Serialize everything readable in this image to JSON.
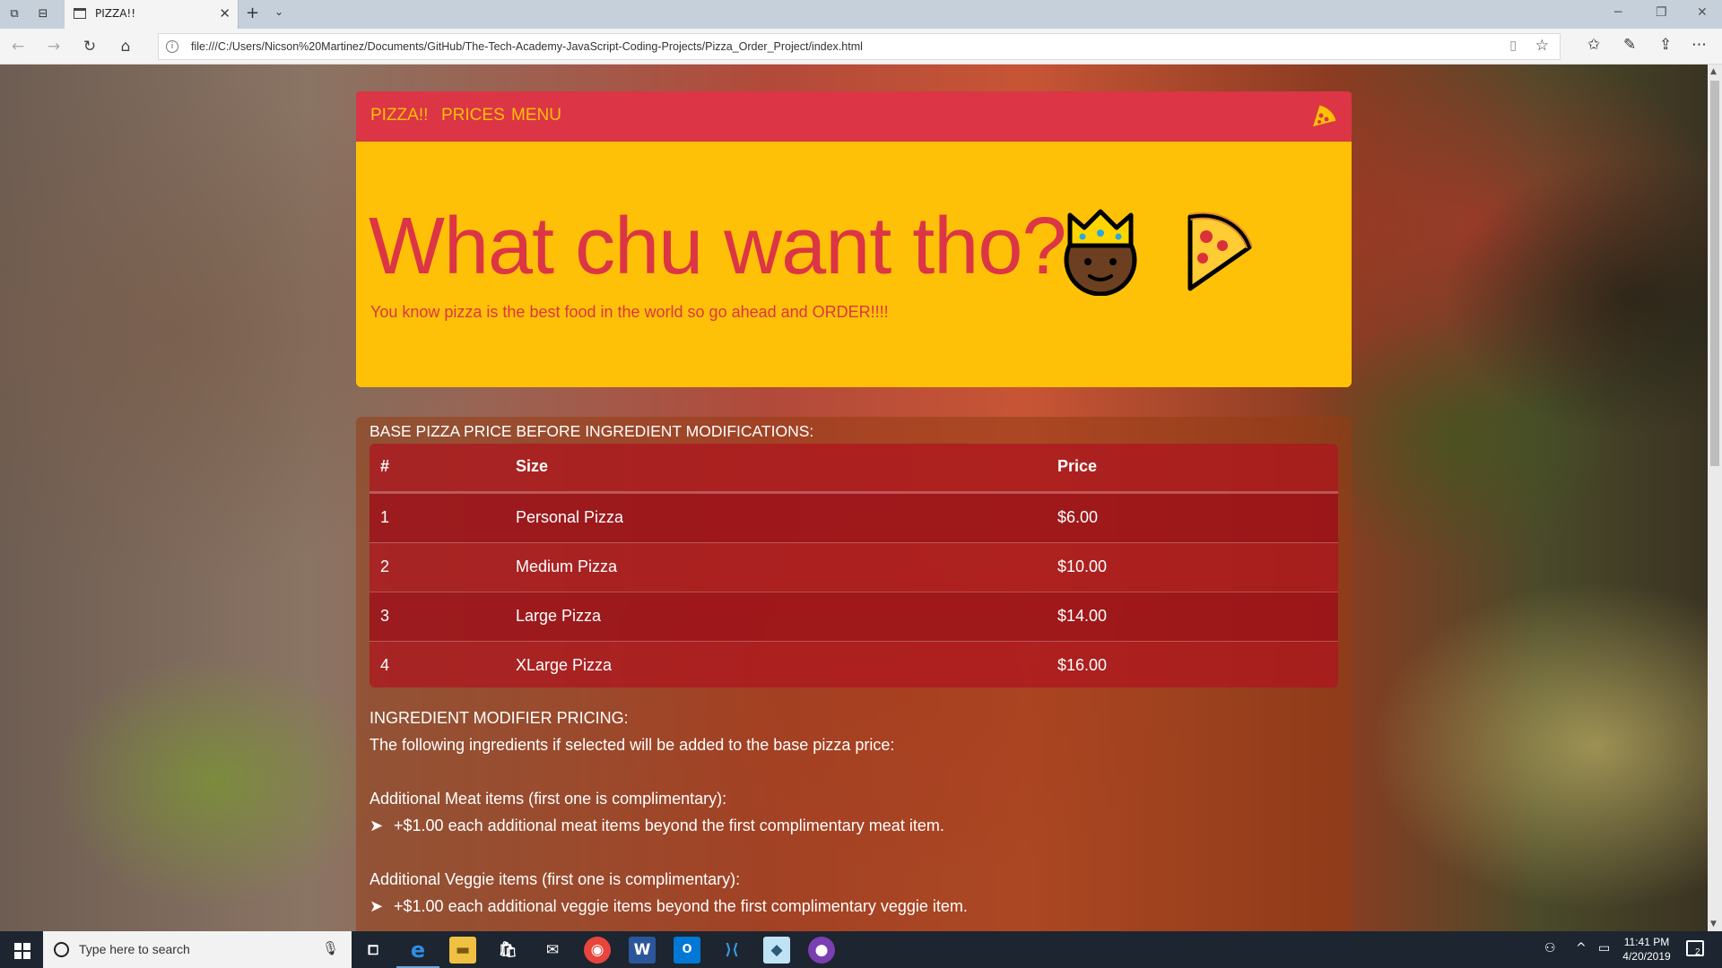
{
  "browser": {
    "tab_title": "PIZZA!!",
    "url": "file:///C:/Users/Nicson%20Martinez/Documents/GitHub/The-Tech-Academy-JavaScript-Coding-Projects/Pizza_Order_Project/index.html"
  },
  "site_nav": {
    "brand": "PIZZA!!",
    "links": [
      "PRICES",
      "MENU"
    ]
  },
  "jumbotron": {
    "heading": "What chu want tho?",
    "lead": "You know pizza is the best food in the world so go ahead and ORDER!!!!"
  },
  "prices": {
    "caption": "BASE PIZZA PRICE BEFORE INGREDIENT MODIFICATIONS:",
    "columns": [
      "#",
      "Size",
      "Price"
    ],
    "rows": [
      [
        "1",
        "Personal Pizza",
        "$6.00"
      ],
      [
        "2",
        "Medium Pizza",
        "$10.00"
      ],
      [
        "3",
        "Large Pizza",
        "$14.00"
      ],
      [
        "4",
        "XLarge Pizza",
        "$16.00"
      ]
    ]
  },
  "modifiers": {
    "title": "INGREDIENT MODIFIER PRICING:",
    "intro": "The following ingredients if selected will be added to the base pizza price:",
    "meat_title": "Additional Meat items (first one is complimentary):",
    "meat_rule": "+$1.00 each additional meat items beyond the first complimentary meat item.",
    "veggie_title": "Additional Veggie items (first one is complimentary):",
    "veggie_rule": "+$1.00 each additional veggie items beyond the first complimentary veggie item.",
    "bullet": "➤"
  },
  "taskbar": {
    "search_placeholder": "Type here to search",
    "time": "11:41 PM",
    "date": "4/20/2019",
    "notification_count": "2"
  },
  "colors": {
    "nav_red": "#dc3545",
    "jumbo_yellow": "#ffc107"
  }
}
